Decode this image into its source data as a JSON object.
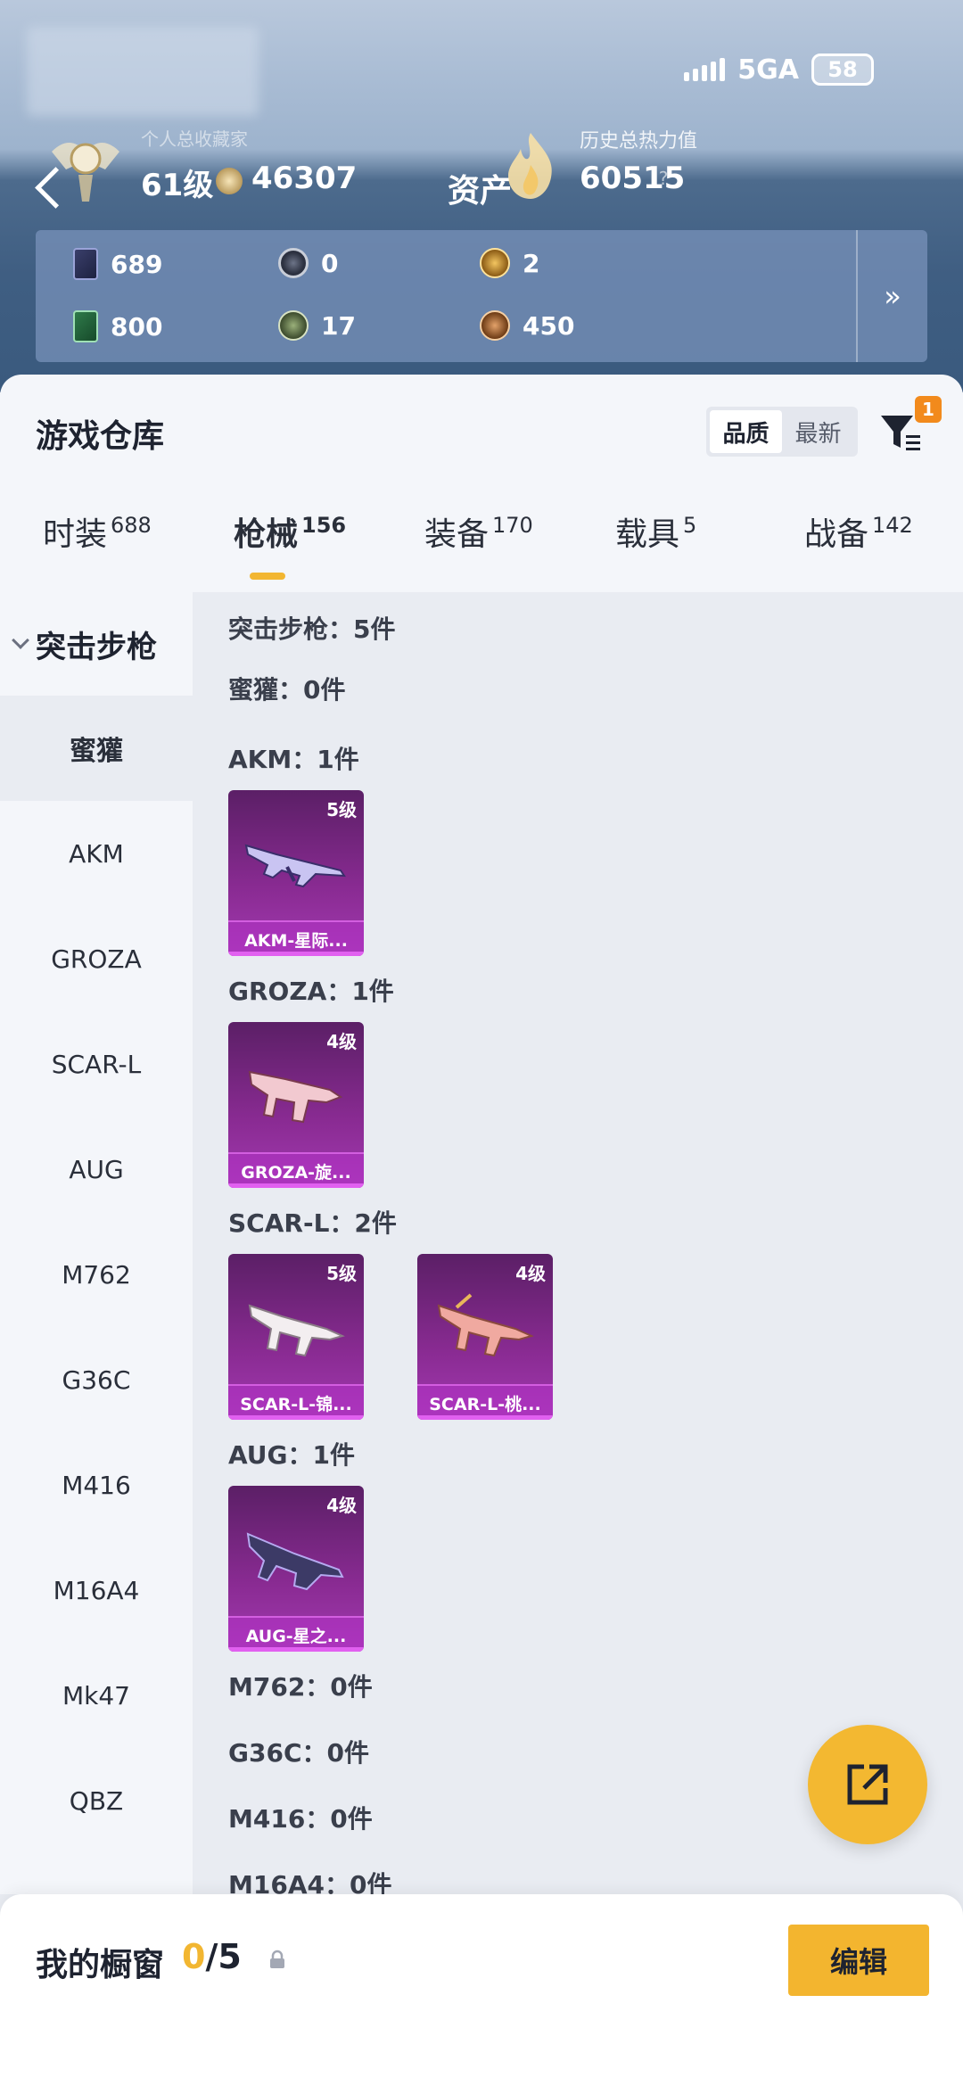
{
  "status_bar": {
    "network": "5GA",
    "battery": "58"
  },
  "profile": {
    "collection_label": "个人总收藏家",
    "level": "61级",
    "coins": "46307",
    "asset_label": "资产",
    "heat_label": "历史总热力值",
    "heat_value": "60515",
    "help": "?"
  },
  "currencies": [
    {
      "icon": "card-icon",
      "value": "689"
    },
    {
      "icon": "ring-coin-icon",
      "value": "0"
    },
    {
      "icon": "gold-coin-icon",
      "value": "2"
    },
    {
      "icon": "green-card-icon",
      "value": "800"
    },
    {
      "icon": "olive-coin-icon",
      "value": "17"
    },
    {
      "icon": "bronze-coin-icon",
      "value": "450"
    }
  ],
  "warehouse": {
    "title": "游戏仓库",
    "sort_options": [
      "品质",
      "最新"
    ],
    "sort_selected": "品质",
    "filter_badge": "1"
  },
  "tabs": [
    {
      "label": "时装",
      "count": "688"
    },
    {
      "label": "枪械",
      "count": "156",
      "active": true
    },
    {
      "label": "装备",
      "count": "170"
    },
    {
      "label": "载具",
      "count": "5"
    },
    {
      "label": "战备",
      "count": "142"
    }
  ],
  "sidebar": {
    "group": "突击步枪",
    "items": [
      "蜜獾",
      "AKM",
      "GROZA",
      "SCAR-L",
      "AUG",
      "M762",
      "G36C",
      "M416",
      "M16A4",
      "Mk47",
      "QBZ"
    ]
  },
  "content": {
    "summary": "突击步枪：5件",
    "sections": [
      {
        "label": "蜜獾：0件"
      },
      {
        "label": "AKM：1件",
        "cards": [
          {
            "grade": "5级",
            "name": "AKM-星际..."
          }
        ]
      },
      {
        "label": "GROZA：1件",
        "cards": [
          {
            "grade": "4级",
            "name": "GROZA-旋..."
          }
        ]
      },
      {
        "label": "SCAR-L：2件",
        "cards": [
          {
            "grade": "5级",
            "name": "SCAR-L-锦..."
          },
          {
            "grade": "4级",
            "name": "SCAR-L-桃..."
          }
        ]
      },
      {
        "label": "AUG：1件",
        "cards": [
          {
            "grade": "4级",
            "name": "AUG-星之..."
          }
        ]
      },
      {
        "label": "M762：0件"
      },
      {
        "label": "G36C：0件"
      },
      {
        "label": "M416：0件"
      },
      {
        "label": "M16A4：0件"
      }
    ]
  },
  "showcase": {
    "label": "我的橱窗",
    "current": "0",
    "total": "/5",
    "edit": "编辑"
  },
  "colors": {
    "accent": "#f3b52f",
    "card_purple": "#8a2b93",
    "badge_orange": "#f28a1c"
  }
}
